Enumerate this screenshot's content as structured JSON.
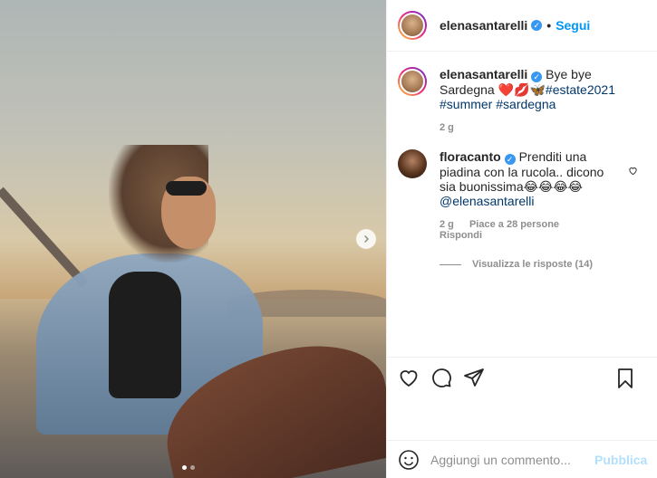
{
  "post": {
    "author": "elenasantarelli",
    "follow_label": "Segui",
    "caption": {
      "username": "elenasantarelli",
      "text": "Bye bye Sardegna",
      "emojis": "❤️💋🦋",
      "hashtags": [
        "#estate2021",
        "#summer",
        "#sardegna"
      ],
      "time": "2 g"
    },
    "comment": {
      "username": "floracanto",
      "text": "Prenditi una piadina con la rucola.. dicono sia buonissima",
      "emojis": "😂😂😂😂",
      "mention": "@elenasantarelli",
      "time": "2 g",
      "likes": "Piace a 28 persone",
      "reply_label": "Rispondi",
      "view_replies": "Visualizza le risposte (14)"
    },
    "add_comment": {
      "placeholder": "Aggiungi un commento...",
      "post_label": "Pubblica"
    }
  },
  "colors": {
    "accent": "#0095f6",
    "verified": "#3897f0",
    "post_disabled": "#b2dffc"
  }
}
